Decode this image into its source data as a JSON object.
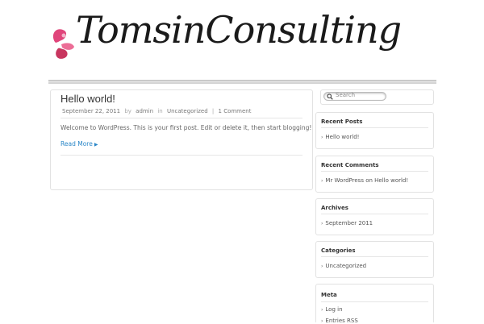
{
  "site": {
    "logo_text": "TomsinConsulting",
    "brand_color": "#e0457b"
  },
  "post": {
    "title": "Hello world!",
    "date": "September 22, 2011",
    "by_label": "by",
    "author": "admin",
    "in_label": "in",
    "category": "Uncategorized",
    "separator": "|",
    "comments": "1 Comment",
    "excerpt": "Welcome to WordPress. This is your first post. Edit or delete it, then start blogging!",
    "read_more": "Read More",
    "read_more_icon": "arrow-right-icon"
  },
  "search": {
    "placeholder": "Search",
    "icon": "search-icon"
  },
  "sidebar": {
    "recent_posts": {
      "title": "Recent Posts",
      "items": [
        "Hello world!"
      ]
    },
    "recent_comments": {
      "title": "Recent Comments",
      "items": [
        "Mr WordPress on Hello world!"
      ]
    },
    "archives": {
      "title": "Archives",
      "items": [
        "September 2011"
      ]
    },
    "categories": {
      "title": "Categories",
      "items": [
        "Uncategorized"
      ]
    },
    "meta": {
      "title": "Meta",
      "items": [
        "Log in",
        "Entries RSS"
      ]
    }
  },
  "colors": {
    "link": "#2a87c8",
    "border": "#e2e2e2",
    "text": "#555555"
  }
}
